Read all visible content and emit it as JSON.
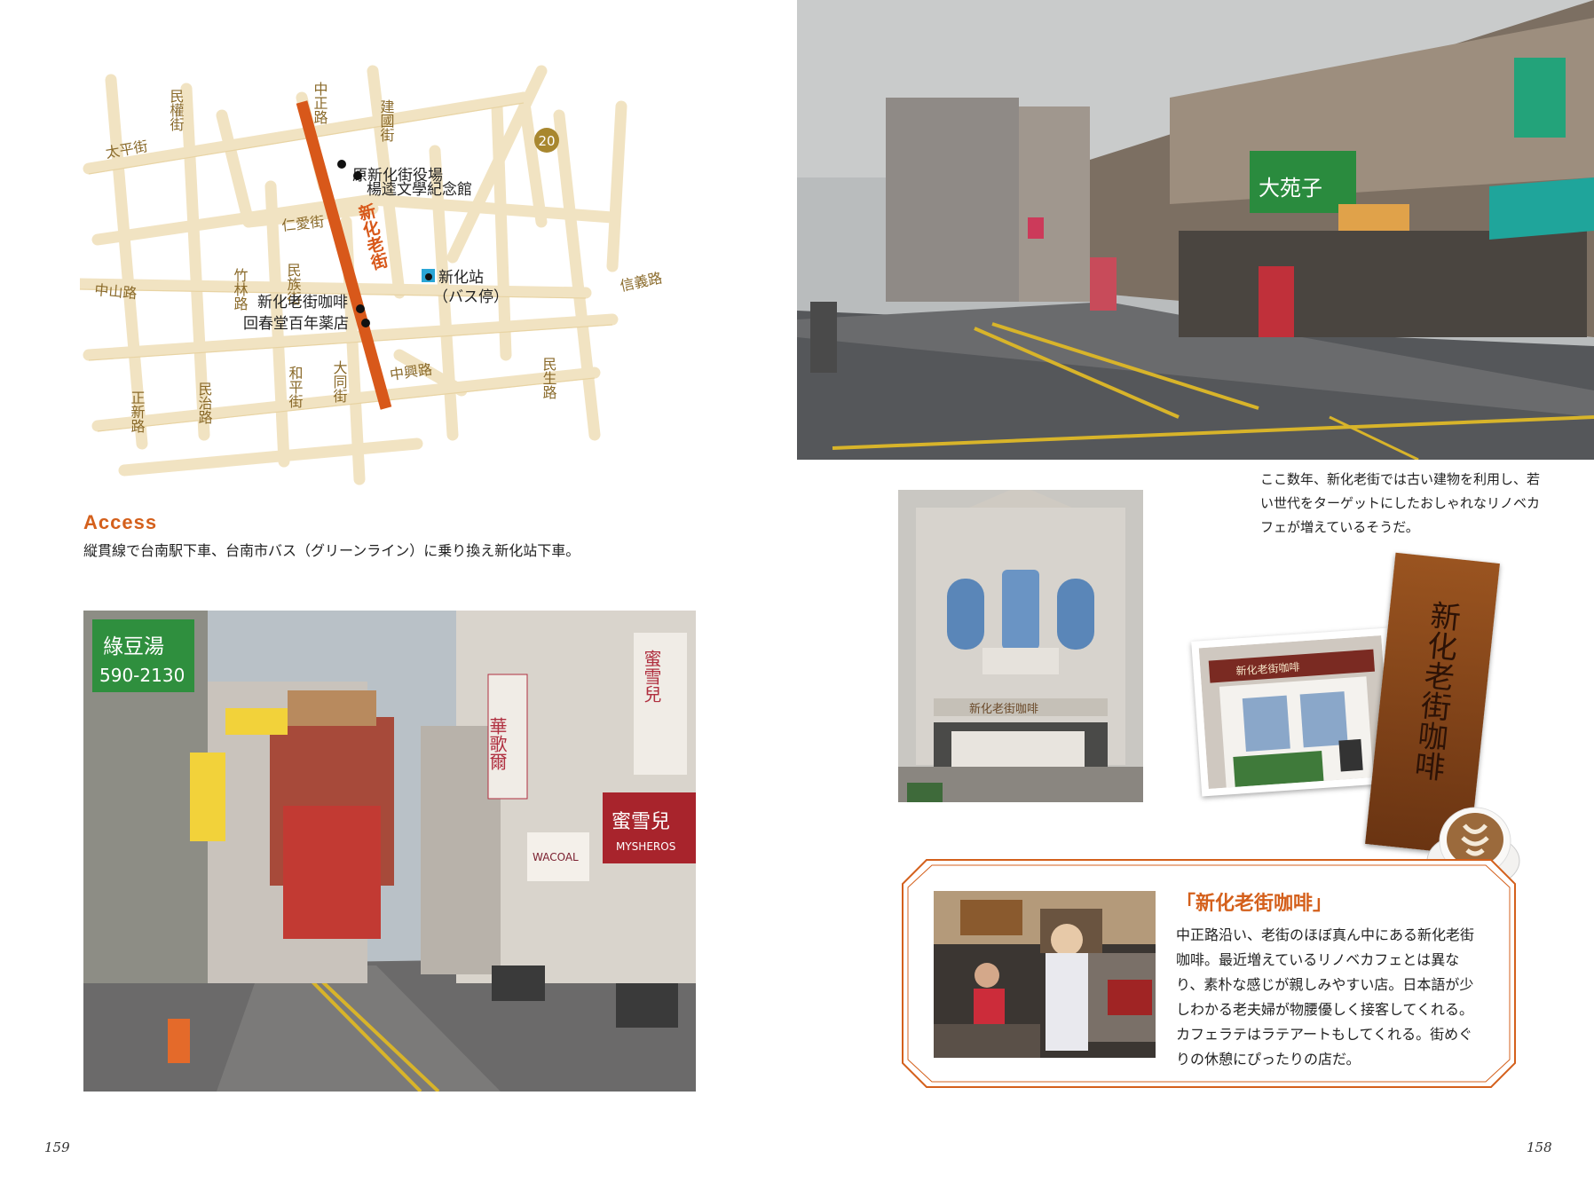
{
  "map": {
    "roads": {
      "taiping": "太平街",
      "minquan": "民權街",
      "zhongzheng": "中正路",
      "jianguo": "建國街",
      "renai": "仁愛街",
      "zhulin": "竹林路",
      "minzu": "民族街",
      "zhongshan": "中山路",
      "xinyi": "信義路",
      "zhongxing": "中興路",
      "zhengxin": "正新路",
      "minzhi": "民治路",
      "heping": "和平街",
      "datong": "大同街",
      "minsheng": "民生路",
      "old_street": "新化老街"
    },
    "route_badge": "20",
    "poi": {
      "town_office": "原新化街役場",
      "yang_kui": "楊逵文學紀念館",
      "cafe": "新化老街咖啡",
      "pharmacy": "回春堂百年薬店",
      "station_name": "新化站",
      "station_sub": "（バス停）"
    }
  },
  "access": {
    "title": "Access",
    "text": "縦貫線で台南駅下車、台南市バス（グリーンライン）に乗り換え新化站下車。"
  },
  "caption_top": "ここ数年、新化老街では古い建物を利用し、若い世代をターゲットにしたおしゃれなリノベカフェが増えているそうだ。",
  "photo_signs": {
    "mung_bean": "綠豆湯",
    "phone": "590-2130",
    "hua_ge_er": "華歌爾",
    "mi_xue_er": "蜜雪兒",
    "mysheros": "MYSHEROS",
    "wacoal": "WACOAL",
    "cafe_facade": "新化老街咖啡",
    "wood_sign": "新化老街咖啡",
    "dayuan": "大苑子"
  },
  "info_box": {
    "title": "「新化老街咖啡」",
    "body": "中正路沿い、老街のほぼ真ん中にある新化老街咖啡。最近増えているリノベカフェとは異なり、素朴な感じが親しみやすい店。日本語が少しわかる老夫婦が物腰優しく接客してくれる。カフェラテはラテアートもしてくれる。街めぐりの休憩にぴったりの店だ。"
  },
  "page_numbers": {
    "left": "159",
    "right": "158"
  },
  "colors": {
    "accent": "#d4601c",
    "road": "#f1e2bf",
    "map_text": "#8a6a2a"
  }
}
